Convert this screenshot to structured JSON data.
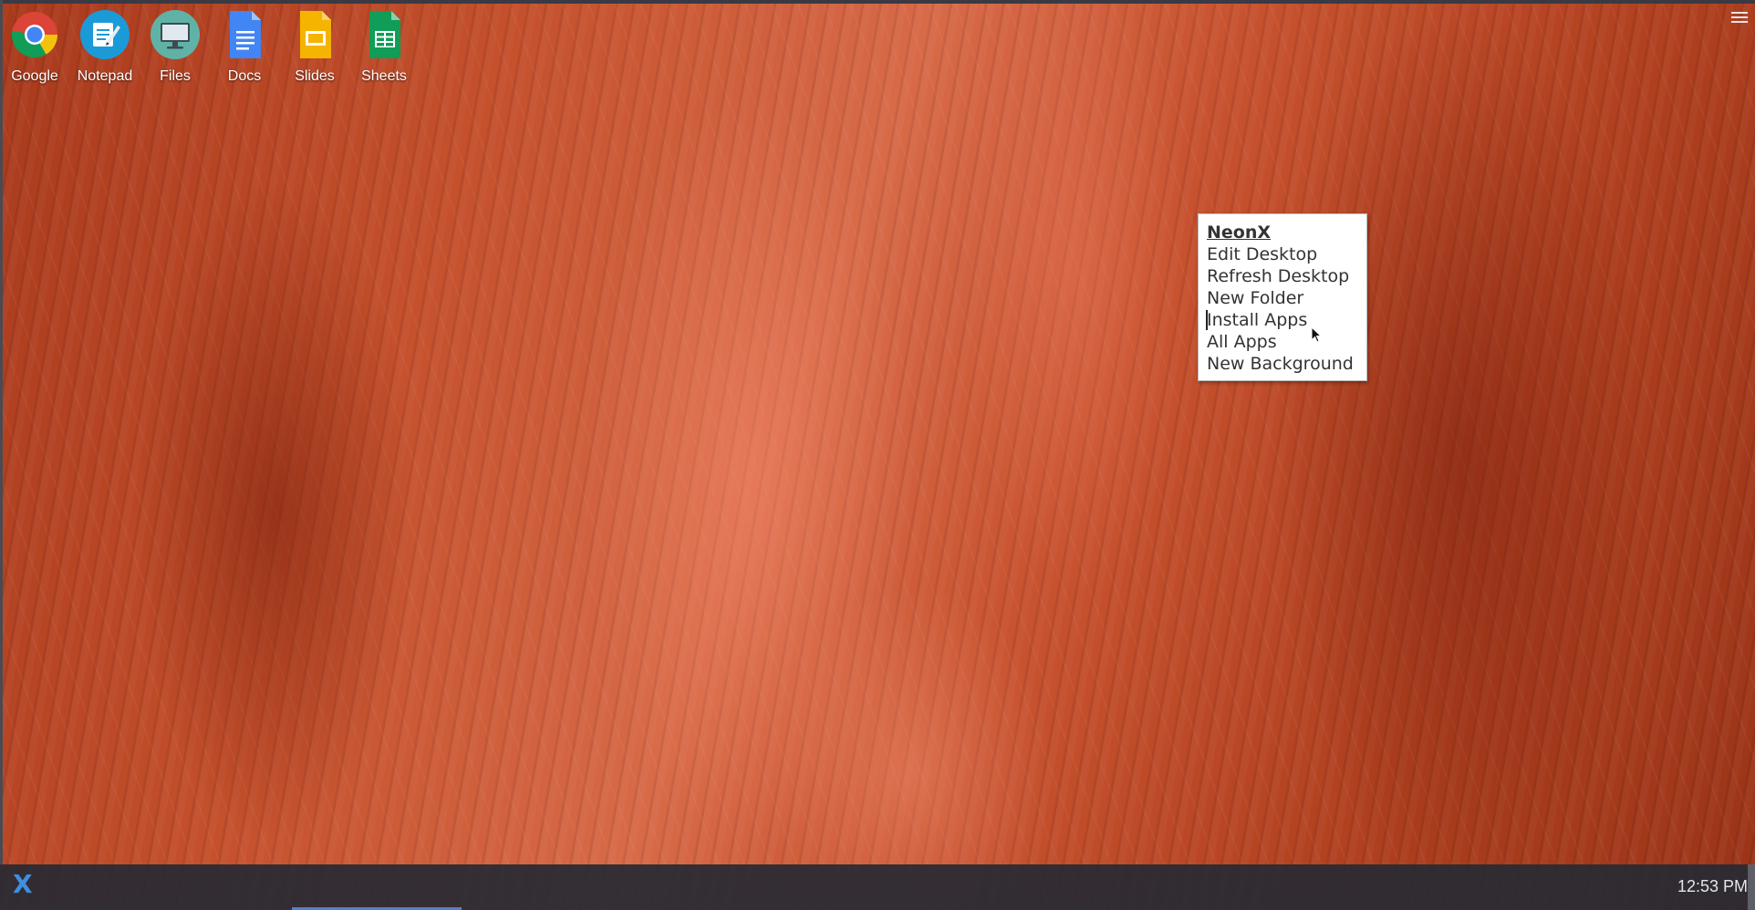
{
  "desktop": {
    "shortcuts": [
      {
        "label": "Google",
        "icon": "chrome-icon"
      },
      {
        "label": "Notepad",
        "icon": "notepad-icon"
      },
      {
        "label": "Files",
        "icon": "monitor-icon"
      },
      {
        "label": "Docs",
        "icon": "docs-icon"
      },
      {
        "label": "Slides",
        "icon": "slides-icon"
      },
      {
        "label": "Sheets",
        "icon": "sheets-icon"
      }
    ],
    "top_right_menu_icon": "hamburger-icon"
  },
  "context_menu": {
    "title": "NeonX",
    "items": [
      "Edit Desktop",
      "Refresh Desktop",
      "New Folder",
      "Install Apps",
      "All Apps",
      "New Background"
    ]
  },
  "taskbar": {
    "start_label": "X",
    "clock": "12:53 PM"
  },
  "colors": {
    "start_accent": "#3f8fe0",
    "taskbar_bg": "#282a34",
    "task_indicator": "#5c7ec8"
  }
}
